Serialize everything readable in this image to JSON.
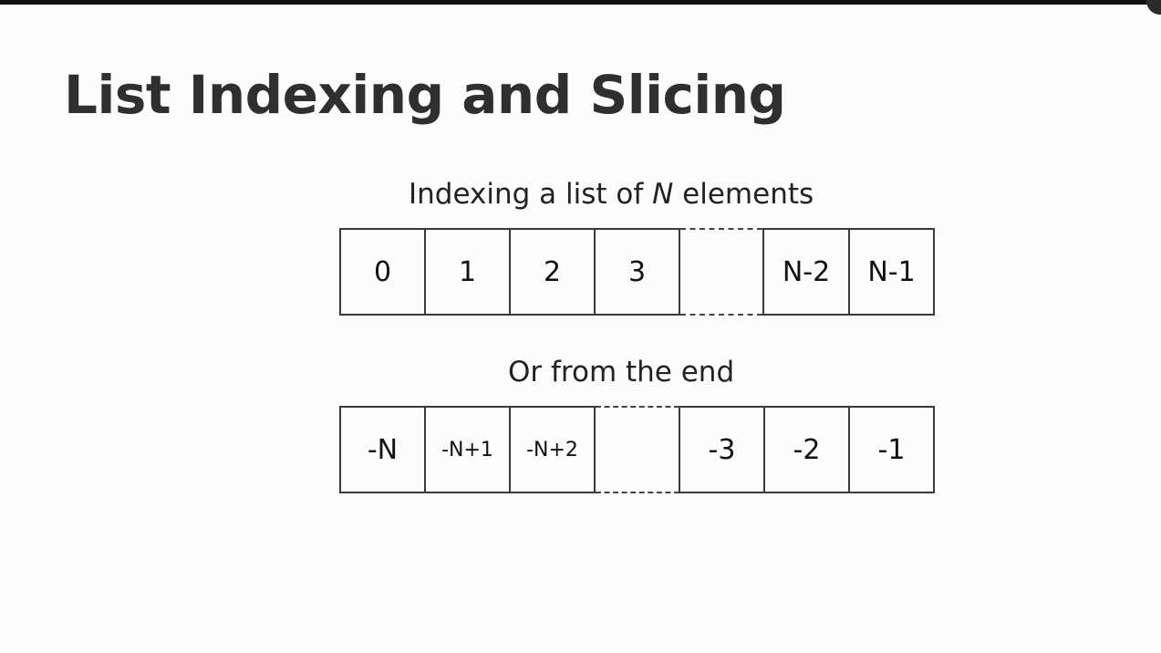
{
  "slide": {
    "title": "List Indexing and Slicing"
  },
  "diagram": {
    "forward": {
      "caption_prefix": "Indexing a list of ",
      "caption_var": "N",
      "caption_suffix": " elements",
      "cells": [
        "0",
        "1",
        "2",
        "3",
        "",
        "N-2",
        "N-1"
      ]
    },
    "backward": {
      "caption": "Or from the end",
      "cells": [
        "-N",
        "-N+1",
        "-N+2",
        "",
        "-3",
        "-2",
        "-1"
      ]
    }
  }
}
